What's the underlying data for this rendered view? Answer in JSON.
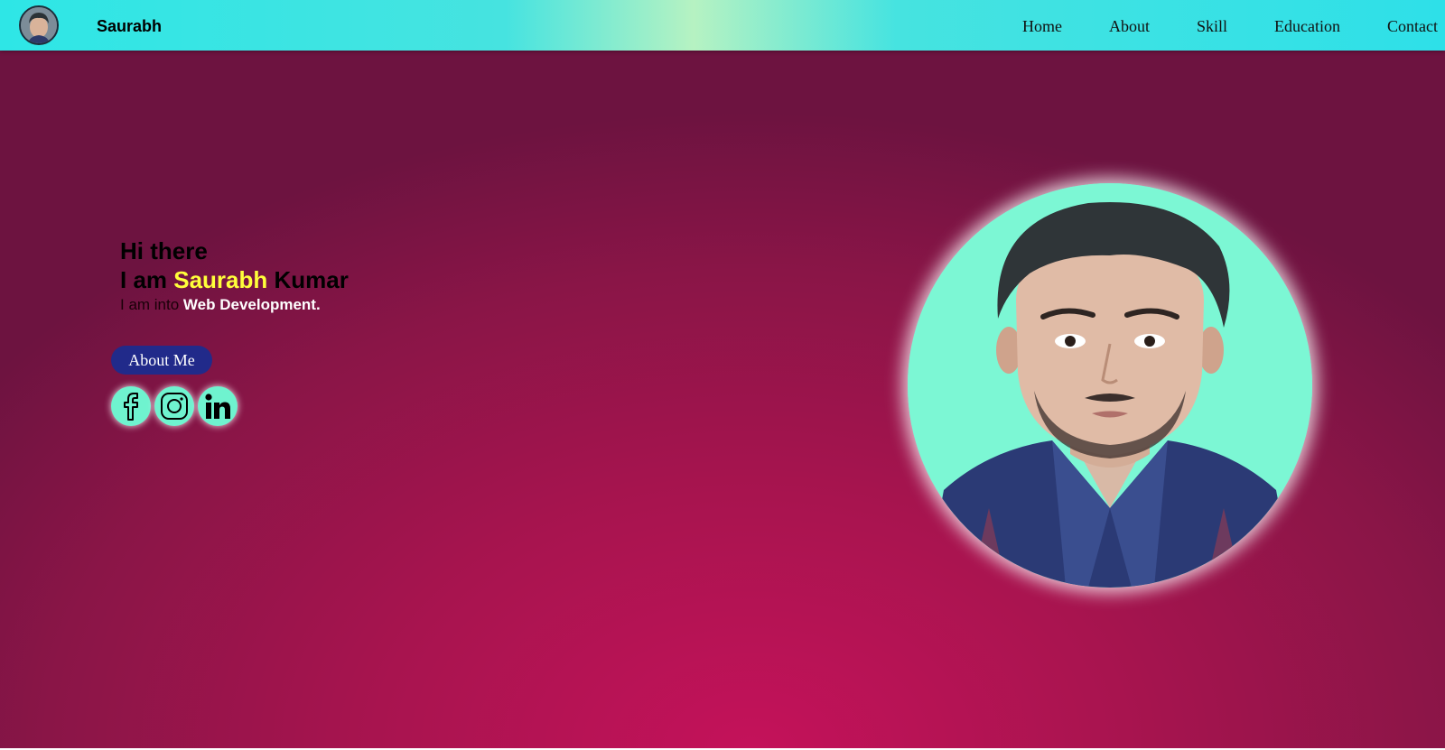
{
  "nav": {
    "brand": "Saurabh",
    "avatar_icon": "profile-avatar",
    "links": [
      "Home",
      "About",
      "Skill",
      "Education",
      "Contact"
    ]
  },
  "hero": {
    "greeting": "Hi there",
    "iam_prefix": "I am ",
    "first_name": "Saurabh",
    "last_name": " Kumar",
    "into_prefix": "I am into ",
    "role": "Web Development.",
    "about_button": "About Me"
  },
  "social": [
    {
      "name": "facebook-icon"
    },
    {
      "name": "instagram-icon"
    },
    {
      "name": "linkedin-icon"
    }
  ],
  "colors": {
    "accent_yellow": "#ffff3a",
    "button_bg": "#212a8a",
    "mint": "#6ff3cf",
    "nav_cyan": "#2ee6e6",
    "background_magenta": "#c4125a"
  }
}
